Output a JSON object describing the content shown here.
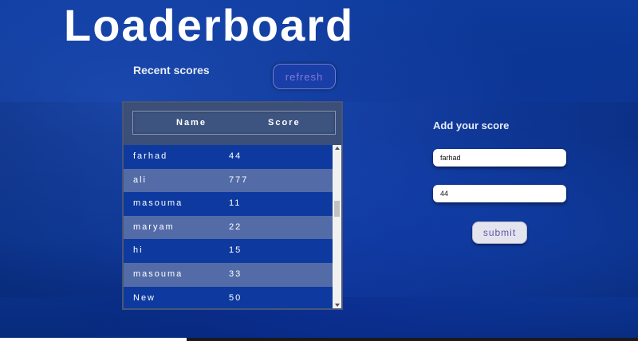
{
  "page": {
    "title": "Loaderboard"
  },
  "scores": {
    "heading": "Recent scores",
    "refresh_label": "refresh",
    "columns": {
      "name": "Name",
      "score": "Score"
    },
    "rows": [
      {
        "name": "farhad",
        "score": "44"
      },
      {
        "name": "ali",
        "score": "777"
      },
      {
        "name": "masouma",
        "score": "11"
      },
      {
        "name": "maryam",
        "score": "22"
      },
      {
        "name": "hi",
        "score": "15"
      },
      {
        "name": "masouma",
        "score": "33"
      },
      {
        "name": "New",
        "score": "50"
      }
    ]
  },
  "add_score": {
    "heading": "Add your score",
    "name_value": "farhad",
    "score_value": "44",
    "submit_label": "submit"
  },
  "colors": {
    "background": "#0b3592",
    "row_alt": "#8c96af",
    "title_text": "#ffffff"
  },
  "icons": {
    "scroll_up": "scroll-up-arrow-icon",
    "scroll_down": "scroll-down-arrow-icon"
  }
}
